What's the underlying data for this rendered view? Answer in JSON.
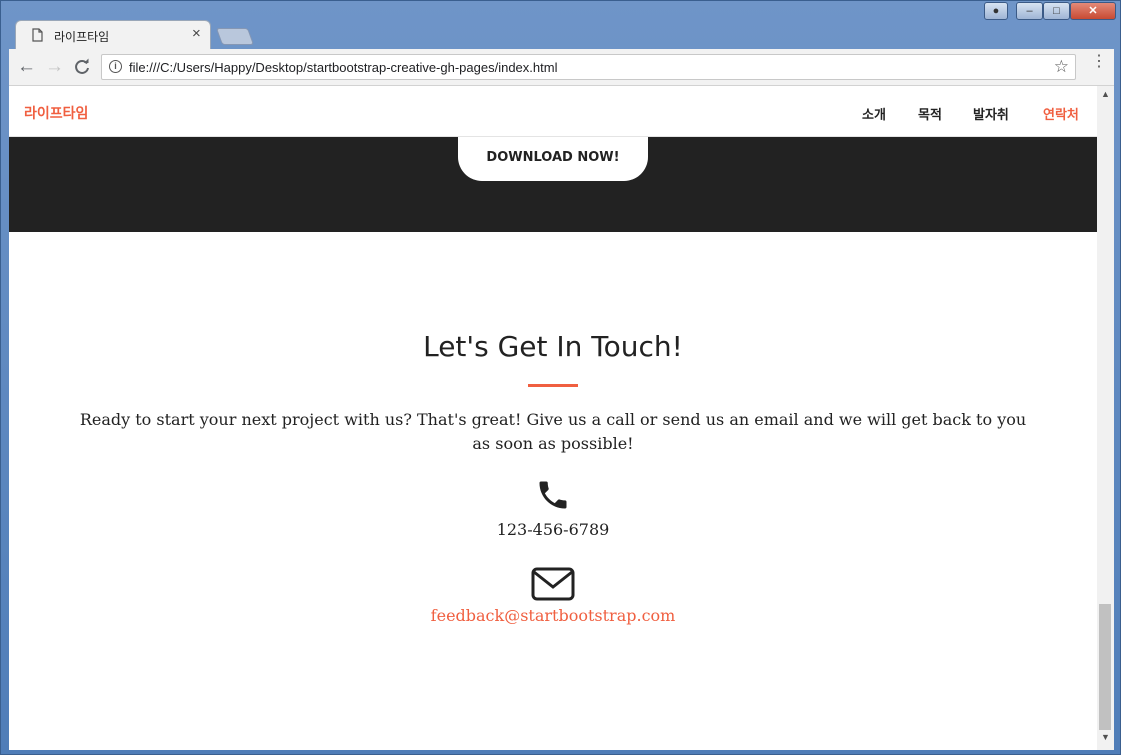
{
  "browser": {
    "tab_title": "라이프타임",
    "tab_close": "×",
    "url": "file:///C:/Users/Happy/Desktop/startbootstrap-creative-gh-pages/index.html"
  },
  "navbar": {
    "brand": "라이프타임",
    "links": [
      "소개",
      "목적",
      "발자취",
      "연락처"
    ],
    "active_link": "연락처"
  },
  "banner": {
    "download_label": "DOWNLOAD NOW!"
  },
  "contact": {
    "title": "Let's Get In Touch!",
    "lead": "Ready to start your next project with us? That's great! Give us a call or send us an email and we will get back to you as soon as possible!",
    "phone": "123-456-6789",
    "email": "feedback@startbootstrap.com"
  },
  "colors": {
    "accent": "#f05f40",
    "dark": "#222222"
  },
  "icons": [
    "page-icon",
    "back-icon",
    "forward-icon",
    "reload-icon",
    "info-icon",
    "star-icon",
    "menu-icon",
    "phone-icon",
    "envelope-icon"
  ]
}
